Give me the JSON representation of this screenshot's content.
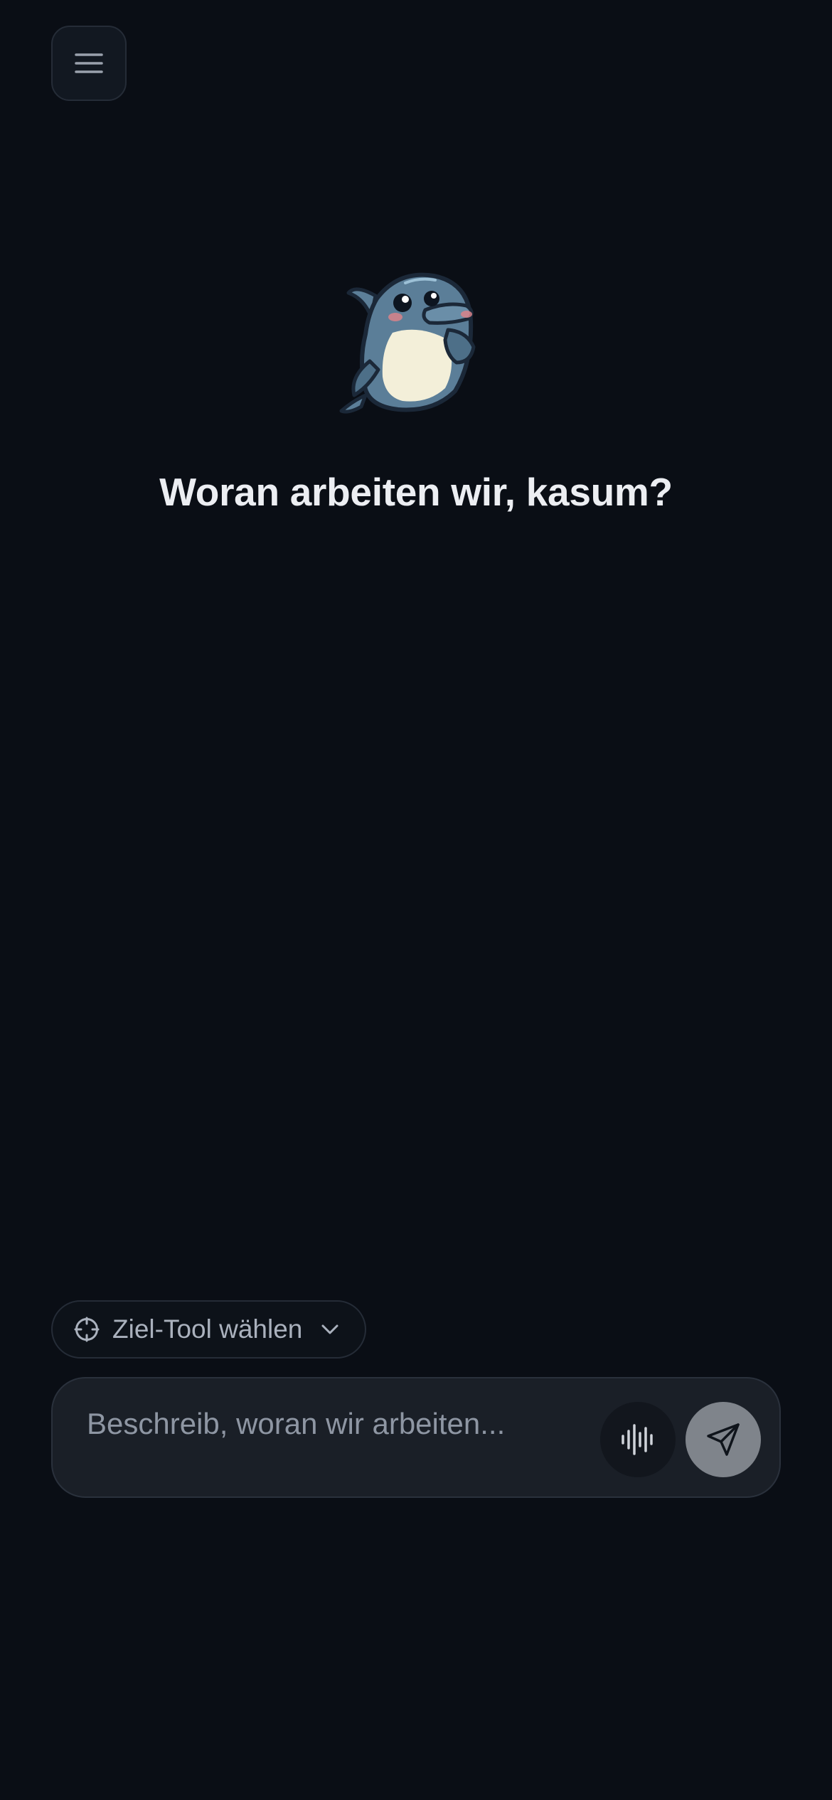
{
  "header": {
    "menu_icon": "hamburger-menu-icon"
  },
  "mascot": {
    "icon": "dolphin-mascot"
  },
  "greeting": {
    "text": "Woran arbeiten wir, kasum?"
  },
  "tool_selector": {
    "icon": "crosshair-icon",
    "label": "Ziel-Tool wählen",
    "chevron": "chevron-down-icon"
  },
  "composer": {
    "placeholder": "Beschreib, woran wir arbeiten...",
    "value": "",
    "voice_icon": "audio-waveform-icon",
    "send_icon": "send-paper-plane-icon"
  },
  "colors": {
    "background": "#0a0e15",
    "surface": "#1a1f27",
    "border": "#252c37",
    "text_primary": "#eceef2",
    "text_muted": "#8e96a3",
    "send_button": "#7f848b"
  }
}
